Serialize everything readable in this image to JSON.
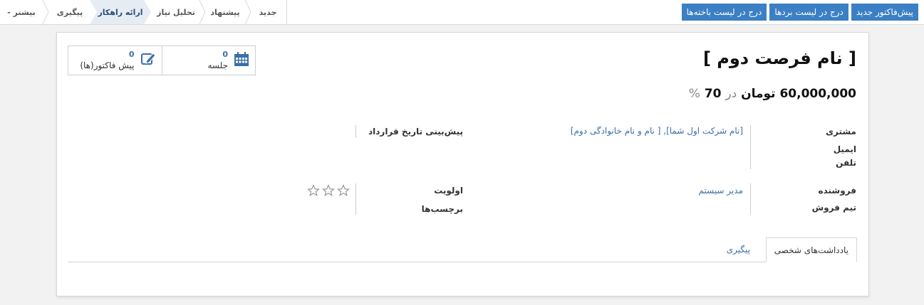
{
  "toolbar": {
    "new_quote": "پیش‌فاکتور جدید",
    "mark_won": "درج در لیست بردها",
    "mark_lost": "درج در لیست باخته‌ها"
  },
  "stages": {
    "items": [
      "جدید",
      "پیشنهاد",
      "تحلیل نیاز",
      "ارائه راهکار",
      "پیگیری"
    ],
    "active": "ارائه راهکار",
    "more": "بیشتر -"
  },
  "smart_buttons": {
    "meetings": {
      "count": "0",
      "label": "جلسه"
    },
    "quotations": {
      "count": "0",
      "label": "پیش فاکتور(ها)"
    }
  },
  "record": {
    "title": "[ نام فرصت دوم ]",
    "expected_revenue": "60,000,000",
    "currency": "تومان",
    "at": "در",
    "probability": "70",
    "percent": "%"
  },
  "fields": {
    "customer_label": "مشتری",
    "customer_value": "[نام شرکت اول شما], [ نام و نام خانوادگی دوم]",
    "email_label": "ایمیل",
    "phone_label": "تلفن",
    "deadline_label": "پیش‌بینی تاریخ قرارداد",
    "salesperson_label": "فروشنده",
    "salesperson_value": "مدیر سیستم",
    "team_label": "تیم فروش",
    "priority_label": "اولویت",
    "tags_label": "برچسب‌ها",
    "priority_stars": 0
  },
  "tabs": {
    "notes": "یادداشت‌های شخصی",
    "followup": "پیگیری"
  },
  "colors": {
    "primary": "#3b7fc4",
    "link": "#3b6ea8",
    "active_stage": "#e6ecf3"
  }
}
